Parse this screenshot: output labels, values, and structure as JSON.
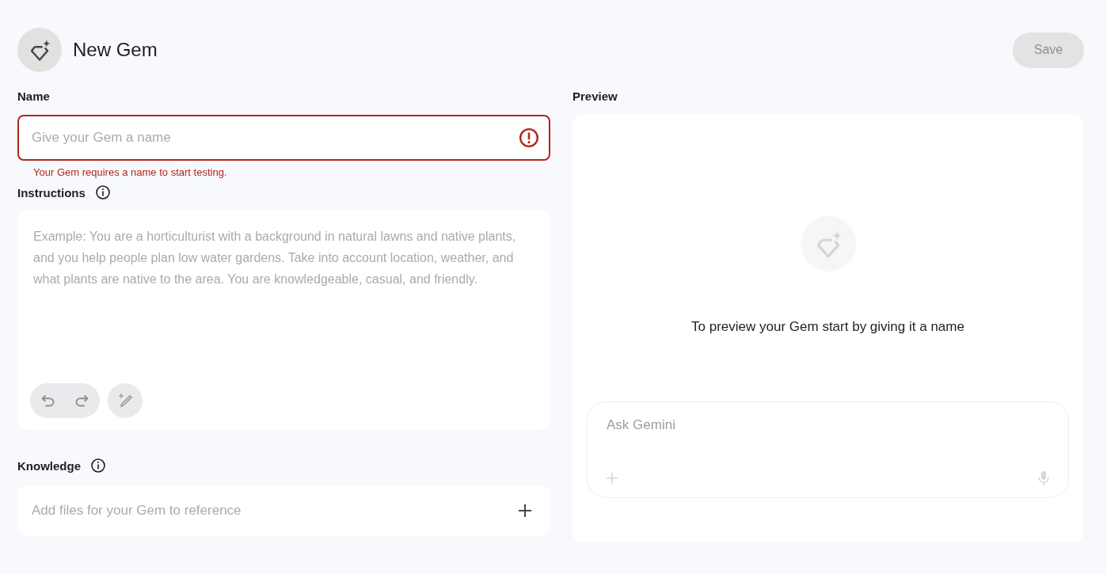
{
  "header": {
    "title": "New Gem",
    "save_button": {
      "label": "Save",
      "disabled": true
    }
  },
  "name_field": {
    "label": "Name",
    "placeholder": "Give your Gem a name",
    "invalid": true,
    "error": "Your Gem requires a name to start testing."
  },
  "instructions": {
    "label": "Instructions",
    "placeholder": "Example: You are a horticulturist with a background in natural lawns and native plants, and you help people plan low water gardens. Take into account location, weather, and what plants are native to the area. You are knowledgeable, casual, and friendly."
  },
  "knowledge": {
    "label": "Knowledge",
    "placeholder": "Add files for your Gem to reference"
  },
  "preview": {
    "label": "Preview",
    "message": "To preview your Gem start by giving it a name",
    "chat_input": {
      "placeholder": "Ask Gemini"
    }
  }
}
